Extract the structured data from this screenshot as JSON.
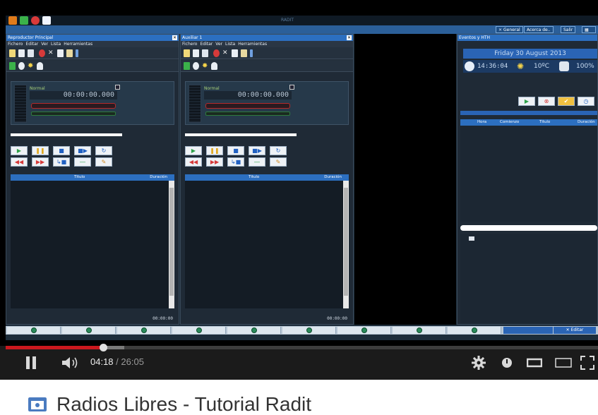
{
  "app": {
    "window_title": "RADIT",
    "sysbar": {
      "general": "General",
      "about": "Acerca de..",
      "exit": "Salir"
    },
    "main_player": {
      "title": "Reproductor Principal",
      "menu": [
        "Fichero",
        "Editar",
        "Ver",
        "Lista",
        "Herramientas"
      ],
      "mode": "Normal",
      "clock": "00:00:00.000",
      "col_title": "Titulo",
      "col_duration": "Duración",
      "total": "00:00:00"
    },
    "aux_player": {
      "title": "Auxiliar 1",
      "menu": [
        "Fichero",
        "Editar",
        "Ver",
        "Lista",
        "Herramientas"
      ],
      "mode": "Normal",
      "clock": "00:00:00.000",
      "col_title": "Titulo",
      "col_duration": "Duración",
      "total": "00:00:00"
    },
    "events": {
      "title": "Eventos y HTH",
      "date": "Friday  30 August 2013",
      "time": "14:36:04",
      "temperature": "10ºC",
      "humidity": "100%",
      "col_time": "Hora",
      "col_start": "Comienzo",
      "col_title": "Titulo",
      "col_duration": "Duración"
    },
    "edit_button": "Editar"
  },
  "video": {
    "current_time": "04:18",
    "separator": " / ",
    "duration": "26:05",
    "progress_fraction": 0.165,
    "buffered_fraction": 0.2,
    "title": "Radios Libres - Tutorial Radit",
    "colors": {
      "played": "#cc181e",
      "bar_bg": "#1b1b1b"
    }
  },
  "icons": {
    "play": "pause-icon",
    "volume": "volume-icon",
    "settings": "gear-icon",
    "annotations": "annotations-icon",
    "theater": "theater-mode-icon",
    "mini": "miniplayer-icon",
    "fullscreen": "fullscreen-icon"
  }
}
